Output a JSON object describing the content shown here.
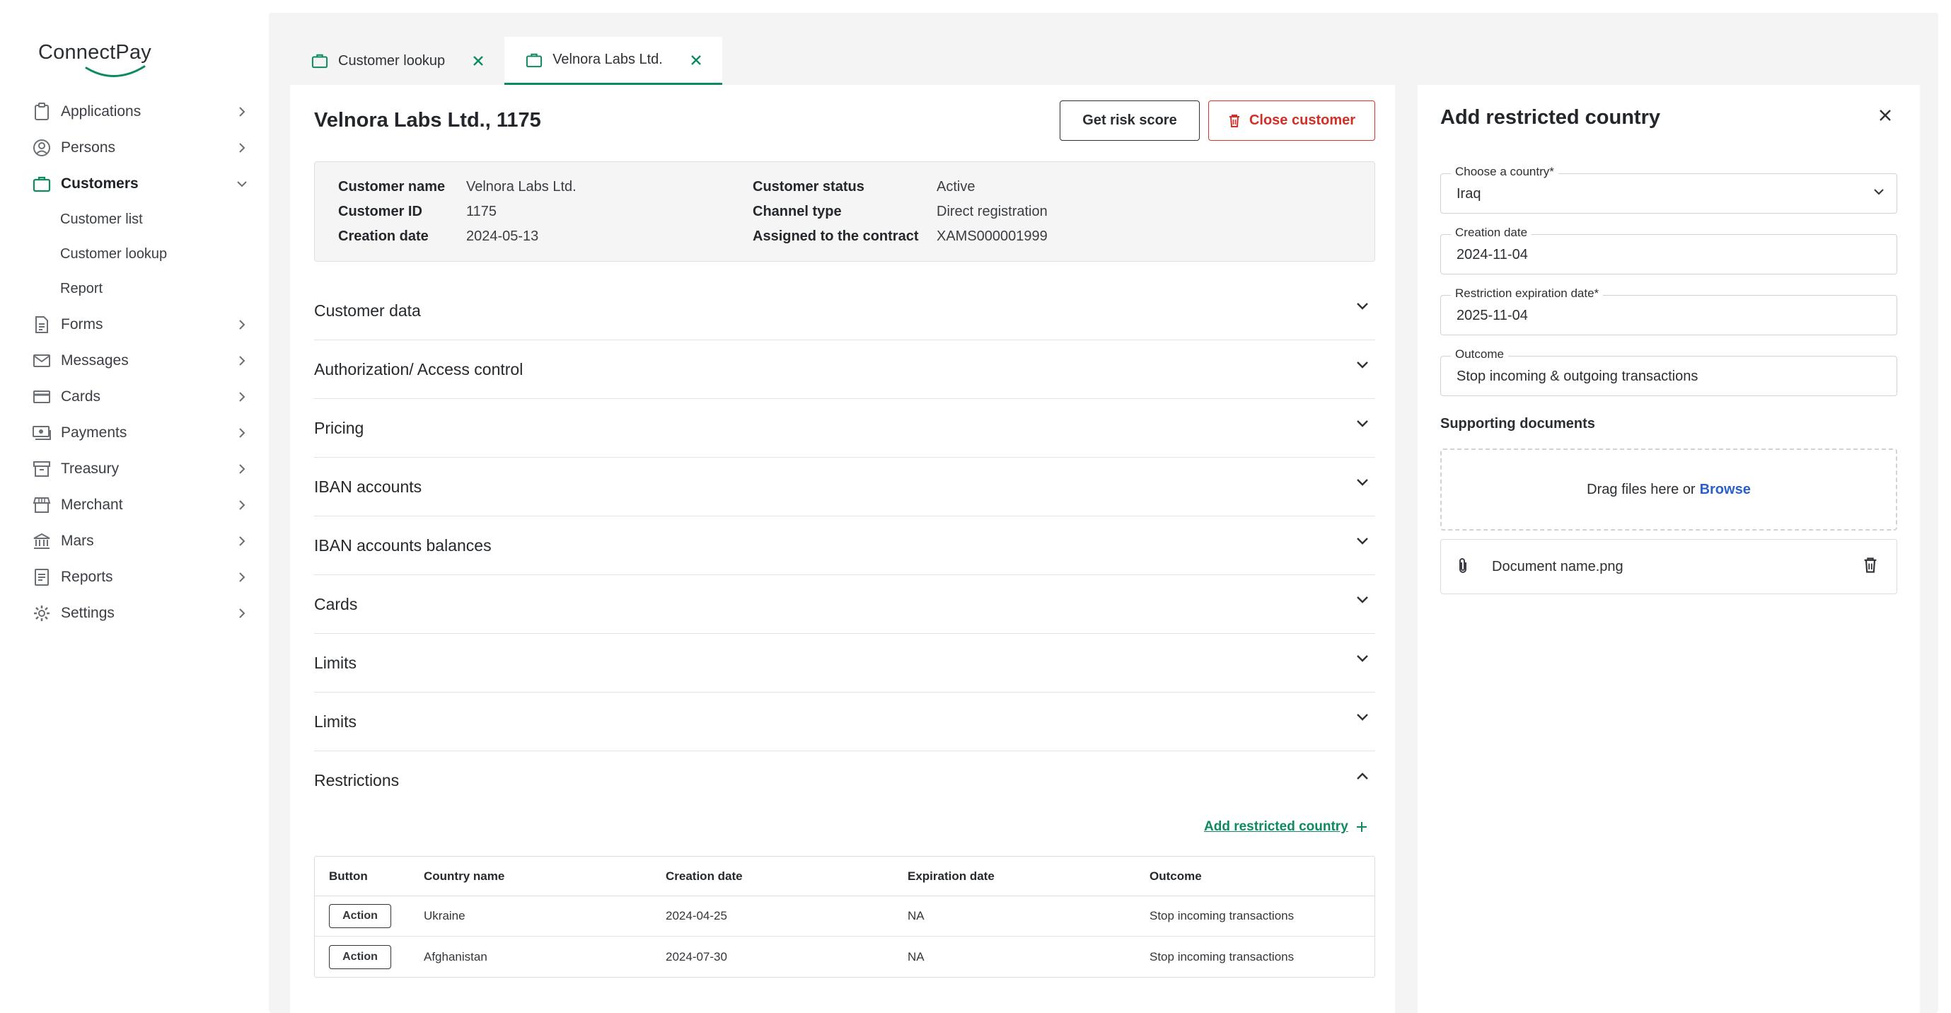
{
  "brand": {
    "name": "ConnectPay",
    "accent": "#0f8a5f"
  },
  "sidebar": {
    "items": [
      {
        "label": "Applications",
        "icon": "clipboard-icon"
      },
      {
        "label": "Persons",
        "icon": "user-circle-icon"
      },
      {
        "label": "Customers",
        "icon": "briefcase-icon",
        "active": true,
        "expanded": true
      },
      {
        "label": "Forms",
        "icon": "document-icon"
      },
      {
        "label": "Messages",
        "icon": "envelope-icon"
      },
      {
        "label": "Cards",
        "icon": "credit-card-icon"
      },
      {
        "label": "Payments",
        "icon": "payments-icon"
      },
      {
        "label": "Treasury",
        "icon": "archive-icon"
      },
      {
        "label": "Merchant",
        "icon": "store-icon"
      },
      {
        "label": "Mars",
        "icon": "bank-icon"
      },
      {
        "label": "Reports",
        "icon": "report-icon"
      },
      {
        "label": "Settings",
        "icon": "gear-icon"
      }
    ],
    "sub_items": [
      "Customer list",
      "Customer lookup",
      "Report"
    ]
  },
  "tabs": [
    {
      "label": "Customer lookup",
      "active": false
    },
    {
      "label": "Velnora Labs Ltd.",
      "active": true
    }
  ],
  "customer": {
    "title": "Velnora Labs Ltd., 1175",
    "buttons": {
      "risk": "Get risk score",
      "close": "Close customer"
    },
    "info": {
      "name_key": "Customer name",
      "name_val": "Velnora Labs Ltd.",
      "id_key": "Customer ID",
      "id_val": "1175",
      "date_key": "Creation date",
      "date_val": "2024-05-13",
      "status_key": "Customer status",
      "status_val": "Active",
      "channel_key": "Channel type",
      "channel_val": "Direct registration",
      "contract_key": "Assigned to the contract",
      "contract_val": "XAMS000001999"
    },
    "sections": [
      "Customer data",
      "Authorization/ Access control",
      "Pricing",
      "IBAN accounts",
      "IBAN accounts balances",
      "Cards",
      "Limits",
      "Limits",
      "Restrictions"
    ],
    "add_restricted_label": "Add restricted country",
    "restrictions_table": {
      "headers": [
        "Button",
        "Country name",
        "Creation date",
        "Expiration date",
        "Outcome"
      ],
      "rows": [
        {
          "action": "Action",
          "country": "Ukraine",
          "created": "2024-04-25",
          "expires": "NA",
          "outcome": "Stop incoming transactions"
        },
        {
          "action": "Action",
          "country": "Afghanistan",
          "created": "2024-07-30",
          "expires": "NA",
          "outcome": "Stop incoming transactions"
        }
      ]
    }
  },
  "panel": {
    "title": "Add restricted country",
    "country": {
      "label": "Choose a country*",
      "value": "Iraq"
    },
    "creation_date": {
      "label": "Creation date",
      "value": "2024-11-04"
    },
    "expiration_date": {
      "label": "Restriction expiration date*",
      "value": "2025-11-04"
    },
    "outcome": {
      "label": "Outcome",
      "value": "Stop incoming & outgoing transactions"
    },
    "supporting_docs_label": "Supporting documents",
    "dropzone_text": "Drag files here or",
    "browse_label": "Browse",
    "file_name": "Document name.png"
  }
}
